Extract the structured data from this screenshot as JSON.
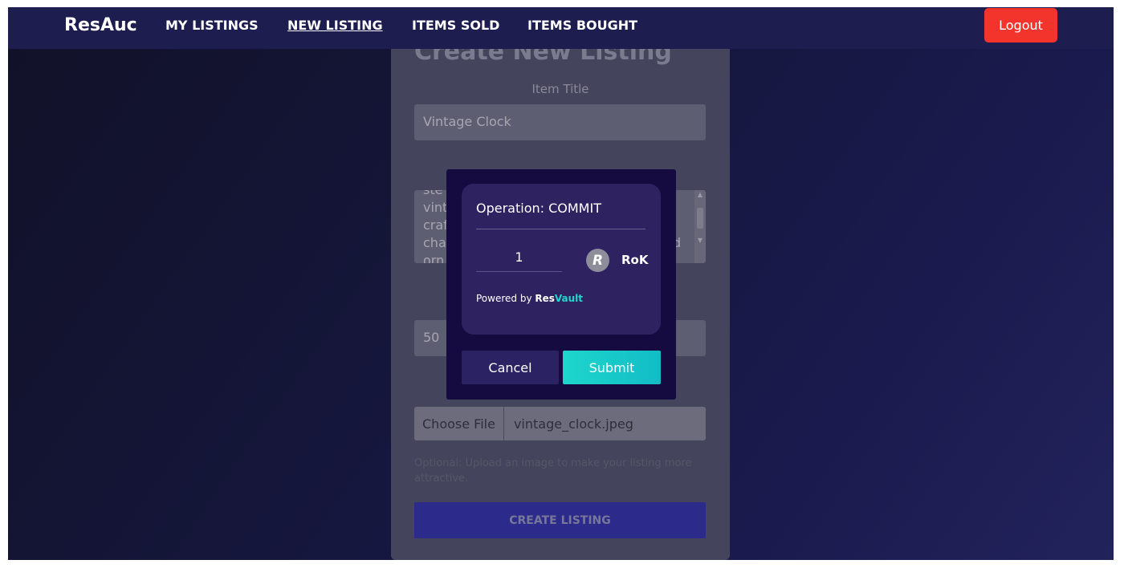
{
  "navbar": {
    "brand": "ResAuc",
    "links": [
      {
        "label": "MY LISTINGS"
      },
      {
        "label": "NEW LISTING",
        "active": true
      },
      {
        "label": "ITEMS SOLD"
      },
      {
        "label": "ITEMS BOUGHT"
      }
    ],
    "logout_label": "Logout"
  },
  "form": {
    "heading": "Create New Listing",
    "title_label": "Item Title",
    "title_value": "Vintage Clock",
    "description_lines": [
      "ste",
      "vint",
      "craf",
      "cha",
      "orn"
    ],
    "description_tail": "d",
    "price_value": "50",
    "file_button_label": "Choose File",
    "file_name": "vintage_clock.jpeg",
    "file_helper": "Optional: Upload an image to make your listing more attractive.",
    "submit_label": "CREATE LISTING"
  },
  "modal": {
    "operation": "Operation: COMMIT",
    "amount": "1",
    "currency_icon": "rok-coin-icon",
    "currency_icon_glyph": "R",
    "currency": "RoK",
    "powered_prefix": "Powered by ",
    "powered_brand_a": "Res",
    "powered_brand_b": "Vault",
    "cancel_label": "Cancel",
    "submit_label": "Submit"
  },
  "colors": {
    "logout": "#f2342d",
    "submit": "#1ed6cc",
    "brand_accent": "#24d4cc"
  }
}
